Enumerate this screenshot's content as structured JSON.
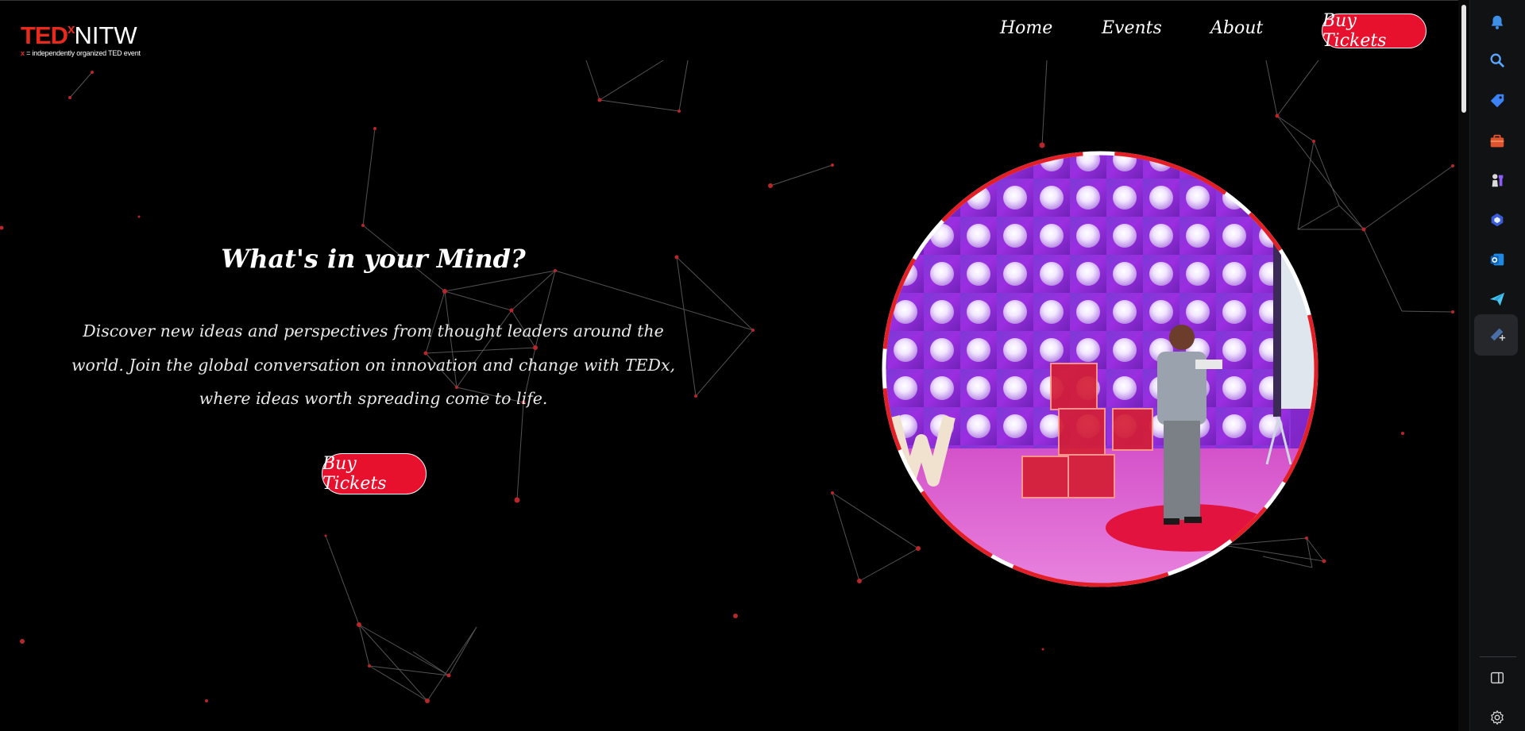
{
  "header": {
    "logo": {
      "brand": "TED",
      "x": "x",
      "name": "NITW",
      "tagline_x": "x",
      "tagline": " = independently organized TED event"
    },
    "nav": [
      "Home",
      "Events",
      "About"
    ],
    "cta": "Buy Tickets"
  },
  "hero": {
    "title": "What's in your Mind?",
    "description": "Discover new ideas and perspectives from thought leaders around the world. Join the global conversation on innovation and change with TEDx, where ideas worth spreading come to life.",
    "cta": "Buy Tickets"
  },
  "sidebar": {
    "items": [
      "bell-icon",
      "search-icon",
      "tag-icon",
      "briefcase-icon",
      "chess-icon",
      "copilot-icon",
      "outlook-icon",
      "send-icon",
      "add-icon"
    ],
    "bottom": [
      "sidebar-toggle-icon",
      "settings-icon"
    ]
  },
  "colors": {
    "accent": "#e8112d",
    "ted_red": "#e62b1e",
    "background": "#000000",
    "sidebar": "#111214"
  }
}
